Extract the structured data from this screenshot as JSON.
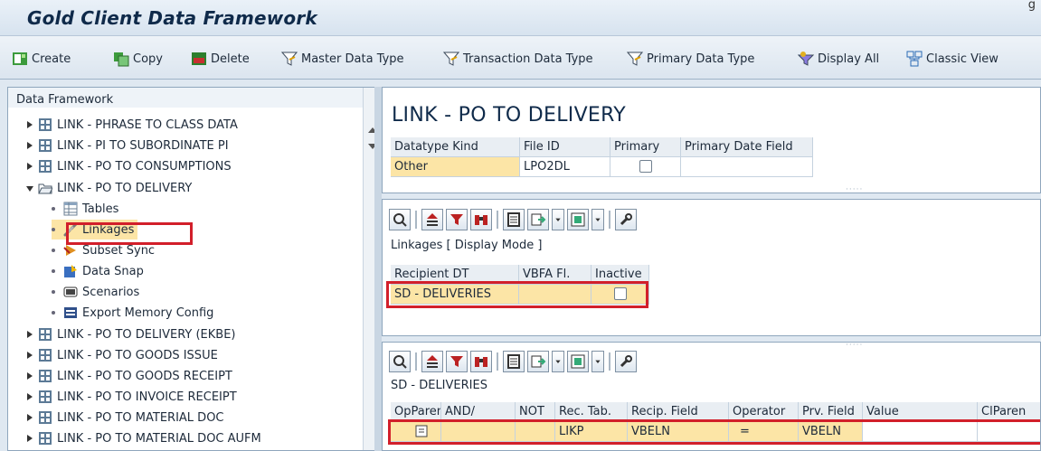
{
  "window": {
    "title": "Gold Client Data Framework",
    "corner_glyph": "g"
  },
  "toolbar": {
    "buttons": [
      {
        "label": "Create",
        "icon": "create-icon"
      },
      {
        "label": "Copy",
        "icon": "copy-icon"
      },
      {
        "label": "Delete",
        "icon": "delete-icon"
      },
      {
        "label": "Master Data Type",
        "icon": "filter-icon"
      },
      {
        "label": "Transaction Data Type",
        "icon": "filter-icon"
      },
      {
        "label": "Primary Data Type",
        "icon": "filter-icon"
      },
      {
        "label": "Display All",
        "icon": "display-all-icon"
      },
      {
        "label": "Classic View",
        "icon": "classic-view-icon"
      }
    ]
  },
  "tree": {
    "header": "Data Framework",
    "items": [
      {
        "label": "LINK - PHRASE TO CLASS DATA",
        "type": "collapsed"
      },
      {
        "label": "LINK - PI TO SUBORDINATE PI",
        "type": "collapsed"
      },
      {
        "label": "LINK - PO TO CONSUMPTIONS",
        "type": "collapsed"
      },
      {
        "label": "LINK - PO TO DELIVERY",
        "type": "expanded"
      },
      {
        "label": "Tables",
        "type": "child",
        "icon": "table-icon"
      },
      {
        "label": "Linkages",
        "type": "child",
        "icon": "linkages-icon"
      },
      {
        "label": "Subset Sync",
        "type": "child",
        "icon": "subset-sync-icon"
      },
      {
        "label": "Data Snap",
        "type": "child",
        "icon": "data-snap-icon"
      },
      {
        "label": "Scenarios",
        "type": "child",
        "icon": "scenarios-icon"
      },
      {
        "label": "Export Memory Config",
        "type": "child",
        "icon": "export-memory-icon"
      },
      {
        "label": "LINK - PO TO DELIVERY (EKBE)",
        "type": "collapsed"
      },
      {
        "label": "LINK - PO TO GOODS ISSUE",
        "type": "collapsed"
      },
      {
        "label": "LINK - PO TO GOODS RECEIPT",
        "type": "collapsed"
      },
      {
        "label": "LINK - PO TO INVOICE RECEIPT",
        "type": "collapsed"
      },
      {
        "label": "LINK - PO TO MATERIAL DOC",
        "type": "collapsed"
      },
      {
        "label": "LINK - PO TO MATERIAL DOC AUFM",
        "type": "collapsed"
      }
    ]
  },
  "header_panel": {
    "title": "LINK - PO TO DELIVERY",
    "columns": [
      "Datatype Kind",
      "File ID",
      "Primary",
      "Primary Date Field"
    ],
    "row": {
      "datatype_kind": "Other",
      "file_id": "LPO2DL",
      "primary": false,
      "primary_date_field": ""
    }
  },
  "linkages_panel": {
    "caption": "Linkages [ Display Mode ]",
    "columns": [
      "Recipient DT",
      "VBFA Fl.",
      "Inactive"
    ],
    "rows": [
      {
        "recipient_dt": "SD - DELIVERIES",
        "vbfa": "",
        "inactive": false
      }
    ]
  },
  "detail_panel": {
    "caption": "SD - DELIVERIES",
    "columns": [
      "OpParen",
      "AND/",
      "NOT",
      "Rec. Tab.",
      "Recip. Field",
      "Operator",
      "Prv. Field",
      "Value",
      "ClParen"
    ],
    "rows": [
      {
        "opparen": "",
        "and": "",
        "not": "",
        "rec_tab": "LIKP",
        "recip_field": "VBELN",
        "operator": "=",
        "prv_field": "VBELN",
        "value": "",
        "clparen": ""
      }
    ]
  },
  "colors": {
    "highlight": "#d21f2a",
    "selected": "#fce5a6",
    "frame": "#8fa6bd",
    "background": "#dfe8f1"
  }
}
